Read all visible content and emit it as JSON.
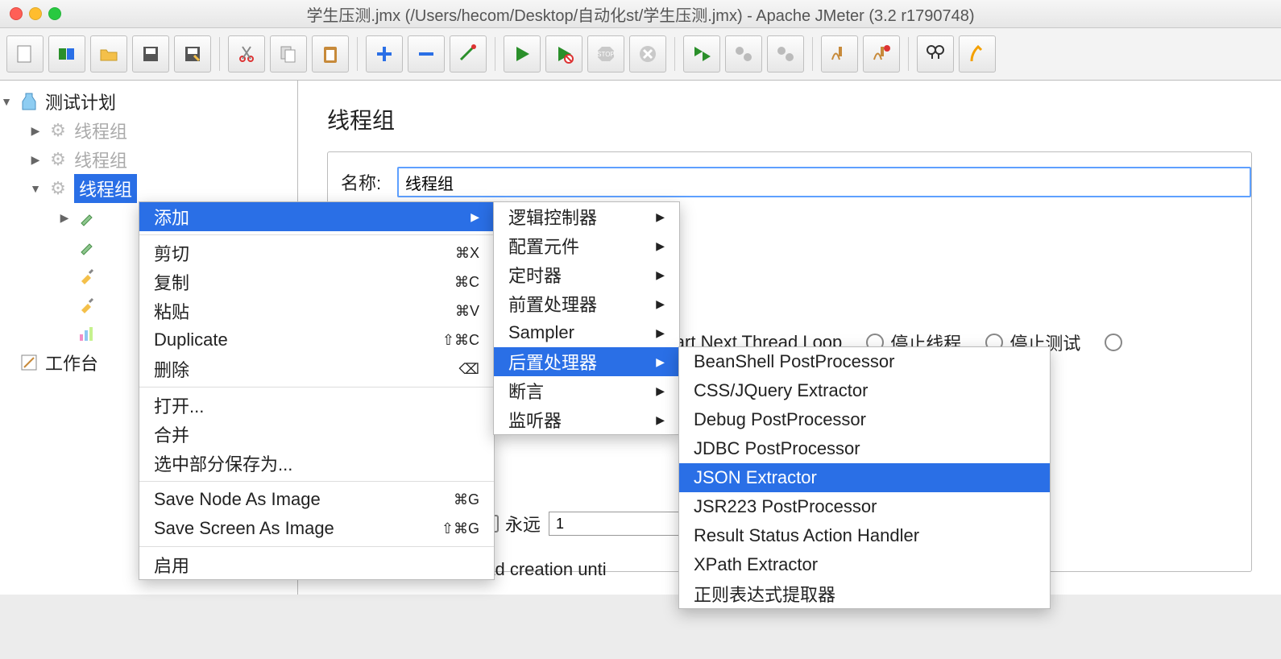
{
  "window": {
    "title": "学生压测.jmx (/Users/hecom/Desktop/自动化st/学生压测.jmx) - Apache JMeter (3.2 r1790748)"
  },
  "tree": {
    "root": "测试计划",
    "nodes": [
      "线程组",
      "线程组",
      "线程组"
    ],
    "workbench": "工作台"
  },
  "panel": {
    "heading": "线程组",
    "name_label": "名称:",
    "name_value": "线程组",
    "start_next": "Start Next Thread Loop",
    "stop_thread": "停止线程",
    "stop_test": "停止测试",
    "loop_forever": "永远",
    "loop_value": "1",
    "delay_label": "Thread creation unti"
  },
  "menu1": {
    "add": "添加",
    "cut": "剪切",
    "cut_sc": "⌘X",
    "copy": "复制",
    "copy_sc": "⌘C",
    "paste": "粘贴",
    "paste_sc": "⌘V",
    "duplicate": "Duplicate",
    "duplicate_sc": "⇧⌘C",
    "delete": "删除",
    "delete_sc": "⌫",
    "open": "打开...",
    "merge": "合并",
    "save_sel": "选中部分保存为...",
    "save_node": "Save Node As Image",
    "save_node_sc": "⌘G",
    "save_screen": "Save Screen As Image",
    "save_screen_sc": "⇧⌘G",
    "enable": "启用"
  },
  "menu2": {
    "logic": "逻辑控制器",
    "config": "配置元件",
    "timer": "定时器",
    "pre": "前置处理器",
    "sampler": "Sampler",
    "post": "后置处理器",
    "assert": "断言",
    "listener": "监听器"
  },
  "menu3": {
    "i1": "BeanShell PostProcessor",
    "i2": "CSS/JQuery Extractor",
    "i3": "Debug PostProcessor",
    "i4": "JDBC PostProcessor",
    "i5": "JSON Extractor",
    "i6": "JSR223 PostProcessor",
    "i7": "Result Status Action Handler",
    "i8": "XPath Extractor",
    "i9": "正则表达式提取器"
  }
}
